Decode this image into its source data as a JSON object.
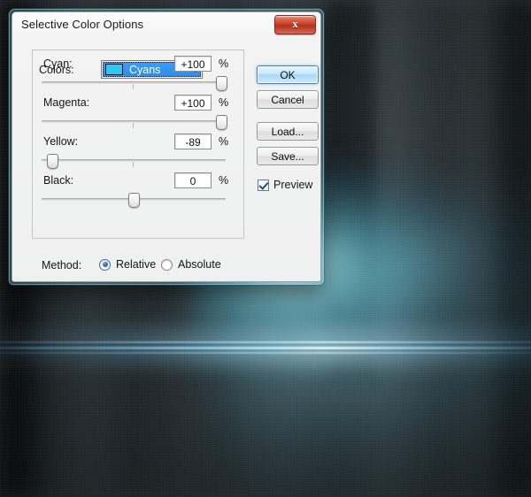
{
  "dialog": {
    "title": "Selective Color Options",
    "close_label": "x",
    "colors_label": "Colors:",
    "colors_value": "Cyans",
    "swatch_color": "#30c8f0",
    "sliders": [
      {
        "label": "Cyan:",
        "value": "+100",
        "unit": "%",
        "percent": 100
      },
      {
        "label": "Magenta:",
        "value": "+100",
        "unit": "%",
        "percent": 100
      },
      {
        "label": "Yellow:",
        "value": "-89",
        "unit": "%",
        "percent": -89
      },
      {
        "label": "Black:",
        "value": "0",
        "unit": "%",
        "percent": 0
      }
    ],
    "buttons": [
      {
        "label": "OK"
      },
      {
        "label": "Cancel"
      },
      {
        "label": "Load..."
      },
      {
        "label": "Save..."
      }
    ],
    "preview_label": "Preview",
    "preview_checked": true,
    "method_label": "Method:",
    "method_options": [
      {
        "label": "Relative",
        "selected": true
      },
      {
        "label": "Absolute",
        "selected": false
      }
    ],
    "accent_color": "#2e8ee8",
    "close_color": "#c33a22",
    "frame_color": "#7ec6d8"
  }
}
